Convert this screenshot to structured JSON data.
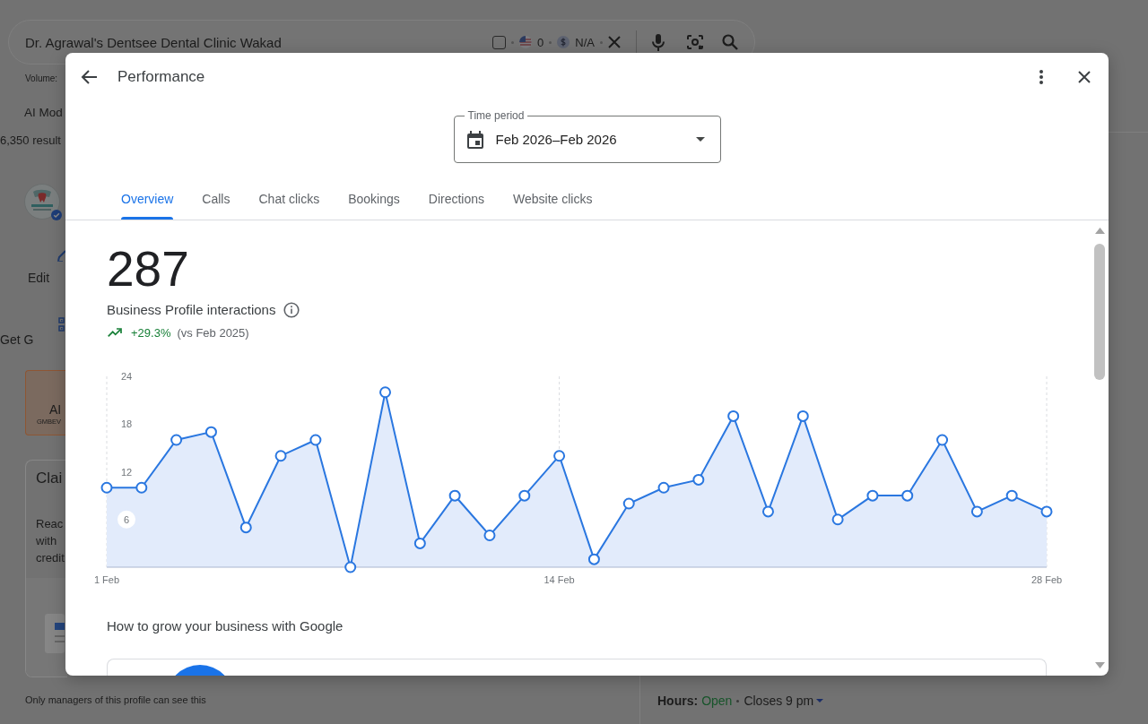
{
  "background_page": {
    "search_bar": {
      "query": "Dr. Agrawal's Dentsee Dental Clinic Wakad",
      "checked": false,
      "count": "0",
      "price": "N/A"
    },
    "volume_label": "Volume:",
    "tab_label": "AI Mod",
    "results_count": "6,350 result",
    "profile_actions": [
      {
        "kind": "edit",
        "label": "Edit"
      },
      {
        "kind": "qr",
        "label": "Get G"
      }
    ],
    "ai_card": {
      "title": "AI",
      "subtitle": "GMBEV"
    },
    "claim_card": {
      "title": "Clai",
      "lines": [
        "Reac",
        "with",
        "credit"
      ]
    },
    "managers_note": "Only managers of this profile can see this",
    "hours": {
      "label": "Hours:",
      "status": "Open",
      "closes": "Closes 9 pm"
    }
  },
  "dialog": {
    "title": "Performance",
    "time_period": {
      "label": "Time period",
      "value": "Feb 2026–Feb 2026"
    },
    "tabs": [
      {
        "label": "Overview",
        "selected": true
      },
      {
        "label": "Calls",
        "selected": false
      },
      {
        "label": "Chat clicks",
        "selected": false
      },
      {
        "label": "Bookings",
        "selected": false
      },
      {
        "label": "Directions",
        "selected": false
      },
      {
        "label": "Website clicks",
        "selected": false
      }
    ],
    "metric": {
      "value": "287",
      "label": "Business Profile interactions",
      "change": "+29.3%",
      "comparison": "(vs Feb 2025)"
    },
    "chart_data": {
      "type": "area",
      "categories": [
        "1 Feb",
        null,
        null,
        null,
        null,
        null,
        null,
        null,
        null,
        null,
        null,
        null,
        null,
        "14 Feb",
        null,
        null,
        null,
        null,
        null,
        null,
        null,
        null,
        null,
        null,
        null,
        null,
        null,
        "28 Feb"
      ],
      "values": [
        10,
        10,
        16,
        17,
        5,
        14,
        16,
        0,
        22,
        3,
        9,
        4,
        9,
        14,
        1,
        8,
        10,
        11,
        19,
        7,
        19,
        6,
        9,
        9,
        16,
        7,
        9,
        7
      ],
      "ylim": [
        0,
        24
      ],
      "yticks": [
        6,
        12,
        18,
        24
      ]
    },
    "section_title": "How to grow your business with Google"
  }
}
